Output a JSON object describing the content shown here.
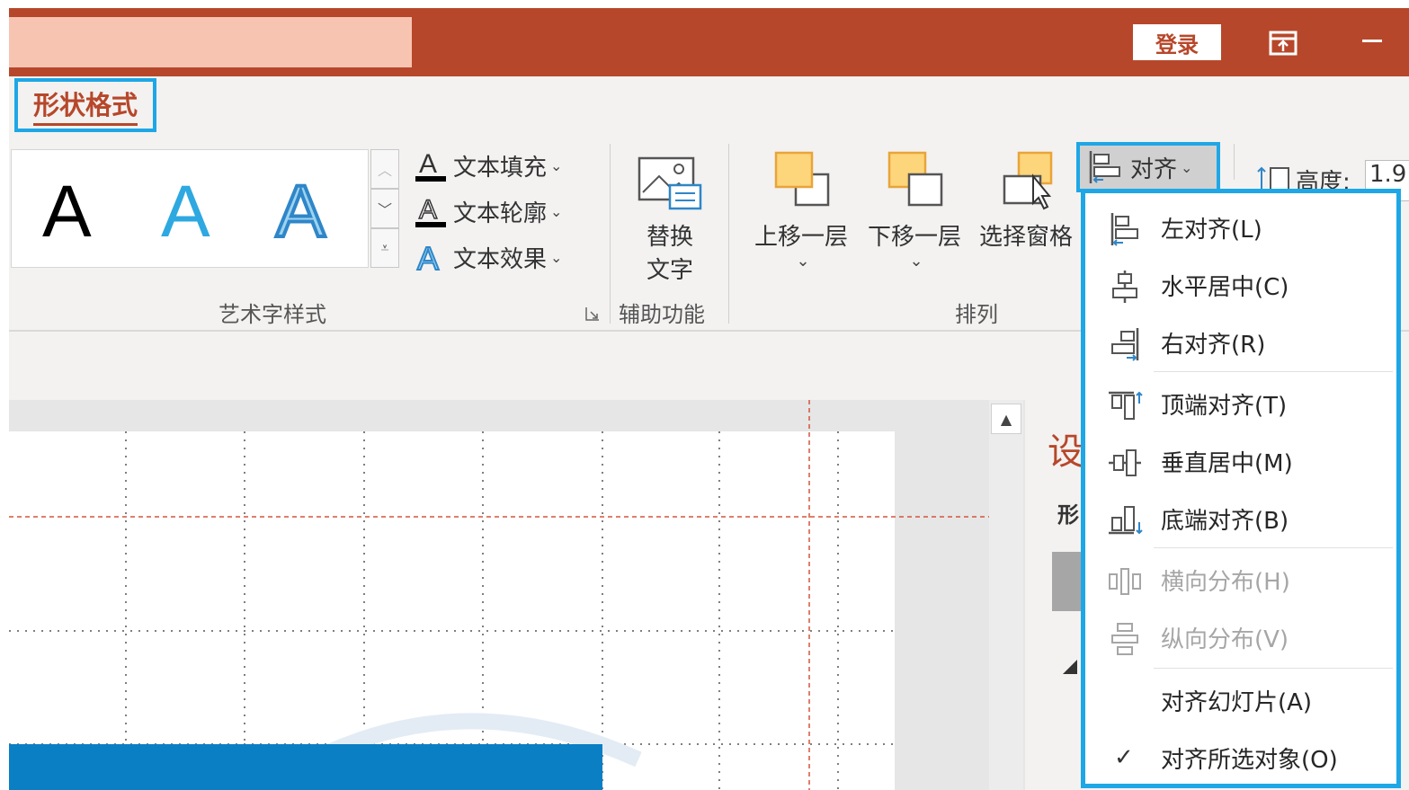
{
  "titlebar": {
    "login_label": "登录",
    "minimize_label": "—"
  },
  "ribbon": {
    "active_tab": "形状格式",
    "wordart": {
      "gallery_letters": [
        "A",
        "A",
        "A"
      ],
      "text_fill": "文本填充",
      "text_outline": "文本轮廓",
      "text_effect": "文本效果",
      "group_label": "艺术字样式"
    },
    "accessibility": {
      "alt_text_line1": "替换",
      "alt_text_line2": "文字",
      "group_label": "辅助功能"
    },
    "arrange": {
      "bring_forward": "上移一层",
      "send_backward": "下移一层",
      "selection_pane": "选择窗格",
      "align": "对齐",
      "group_label": "排列"
    },
    "size": {
      "height_label": "高度:",
      "height_value": "1.9"
    }
  },
  "pane": {
    "title": "设",
    "subtitle": "形"
  },
  "align_menu": {
    "items": [
      {
        "label": "左对齐(L)",
        "icon": "align-left-icon",
        "enabled": true
      },
      {
        "label": "水平居中(C)",
        "icon": "align-center-icon",
        "enabled": true
      },
      {
        "label": "右对齐(R)",
        "icon": "align-right-icon",
        "enabled": true
      },
      {
        "label": "顶端对齐(T)",
        "icon": "align-top-icon",
        "enabled": true
      },
      {
        "label": "垂直居中(M)",
        "icon": "align-middle-icon",
        "enabled": true
      },
      {
        "label": "底端对齐(B)",
        "icon": "align-bottom-icon",
        "enabled": true
      },
      {
        "label": "横向分布(H)",
        "icon": "distribute-horizontal-icon",
        "enabled": false
      },
      {
        "label": "纵向分布(V)",
        "icon": "distribute-vertical-icon",
        "enabled": false
      },
      {
        "label": "对齐幻灯片(A)",
        "icon": "",
        "enabled": true
      },
      {
        "label": "对齐所选对象(O)",
        "icon": "checkmark-icon",
        "enabled": true,
        "checked": true
      }
    ]
  },
  "colors": {
    "accent": "#b7472a",
    "highlight": "#1ea7e6",
    "wordart_blue": "#2ea8e0"
  }
}
